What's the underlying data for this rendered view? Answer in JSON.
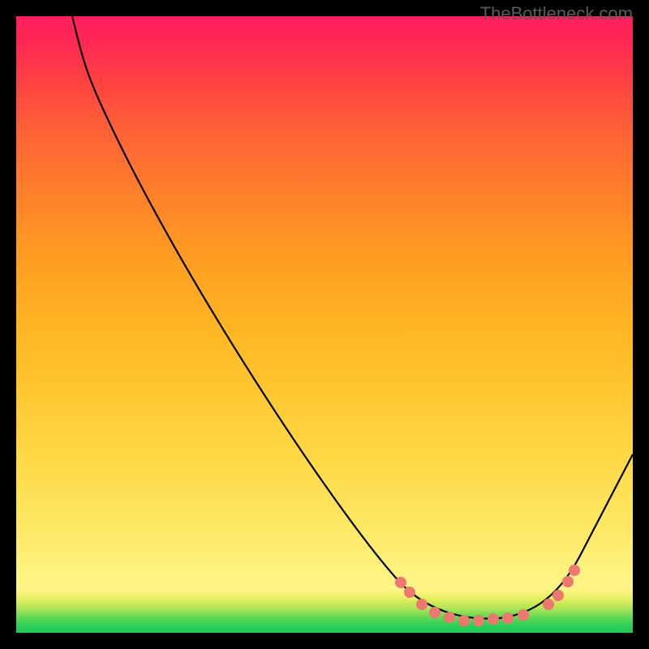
{
  "watermark": "TheBottleneck.com",
  "chart_data": {
    "type": "line",
    "title": "",
    "xlabel": "",
    "ylabel": "",
    "xlim": [
      0,
      100
    ],
    "ylim": [
      0,
      100
    ],
    "background": "heatmap-gradient (red=high bottleneck at top, green=low at bottom)",
    "series": [
      {
        "name": "bottleneck-curve",
        "x": [
          9,
          11,
          14,
          20,
          30,
          40,
          50,
          58,
          63,
          68,
          73,
          78,
          82,
          86,
          90,
          95,
          100
        ],
        "y": [
          100,
          95,
          86,
          72,
          52,
          38,
          26,
          16,
          10,
          6,
          3,
          2,
          2,
          4,
          8,
          19,
          29
        ]
      }
    ],
    "highlight_points": {
      "name": "optimal-range-dots",
      "color": "#ed786f",
      "x": [
        62,
        64,
        66,
        68,
        70,
        73,
        75,
        77,
        80,
        82,
        86,
        88,
        89,
        91
      ],
      "y": [
        8,
        7,
        5,
        3,
        2,
        2,
        2,
        2,
        2,
        3,
        5,
        6,
        8,
        10
      ]
    },
    "legend": false,
    "grid": false
  }
}
